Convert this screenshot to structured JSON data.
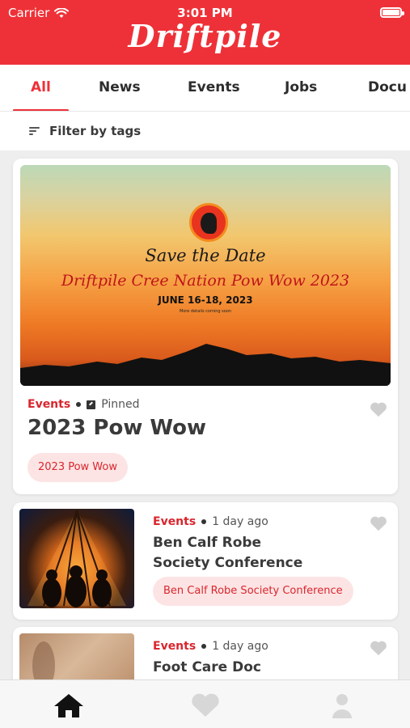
{
  "status_bar": {
    "carrier": "Carrier",
    "time": "3:01 PM"
  },
  "header": {
    "logo": "Driftpile"
  },
  "tabs": [
    {
      "label": "All",
      "active": true
    },
    {
      "label": "News"
    },
    {
      "label": "Events"
    },
    {
      "label": "Jobs"
    },
    {
      "label": "Docu"
    }
  ],
  "filter": {
    "label": "Filter by tags"
  },
  "featured": {
    "hero": {
      "line1": "Save the Date",
      "line2": "Driftpile Cree Nation Pow Wow 2023",
      "line3": "JUNE 16-18, 2023",
      "line4": "More details coming soon"
    },
    "category": "Events",
    "status": "Pinned",
    "title": "2023 Pow Wow",
    "tag": "2023 Pow Wow"
  },
  "posts": [
    {
      "category": "Events",
      "time": "1 day ago",
      "title_line1": "Ben Calf Robe",
      "title_line2": "Society Conference",
      "tag": "Ben Calf Robe Society Conference"
    },
    {
      "category": "Events",
      "time": "1 day ago",
      "title_line1": "Foot Care Doc"
    }
  ],
  "colors": {
    "brand": "#ee3138",
    "chip_bg": "#fde4e4",
    "chip_text": "#d9262e"
  },
  "bottom_nav": {
    "items": [
      "home-icon",
      "heart-icon",
      "profile-icon"
    ],
    "active": "home-icon"
  }
}
